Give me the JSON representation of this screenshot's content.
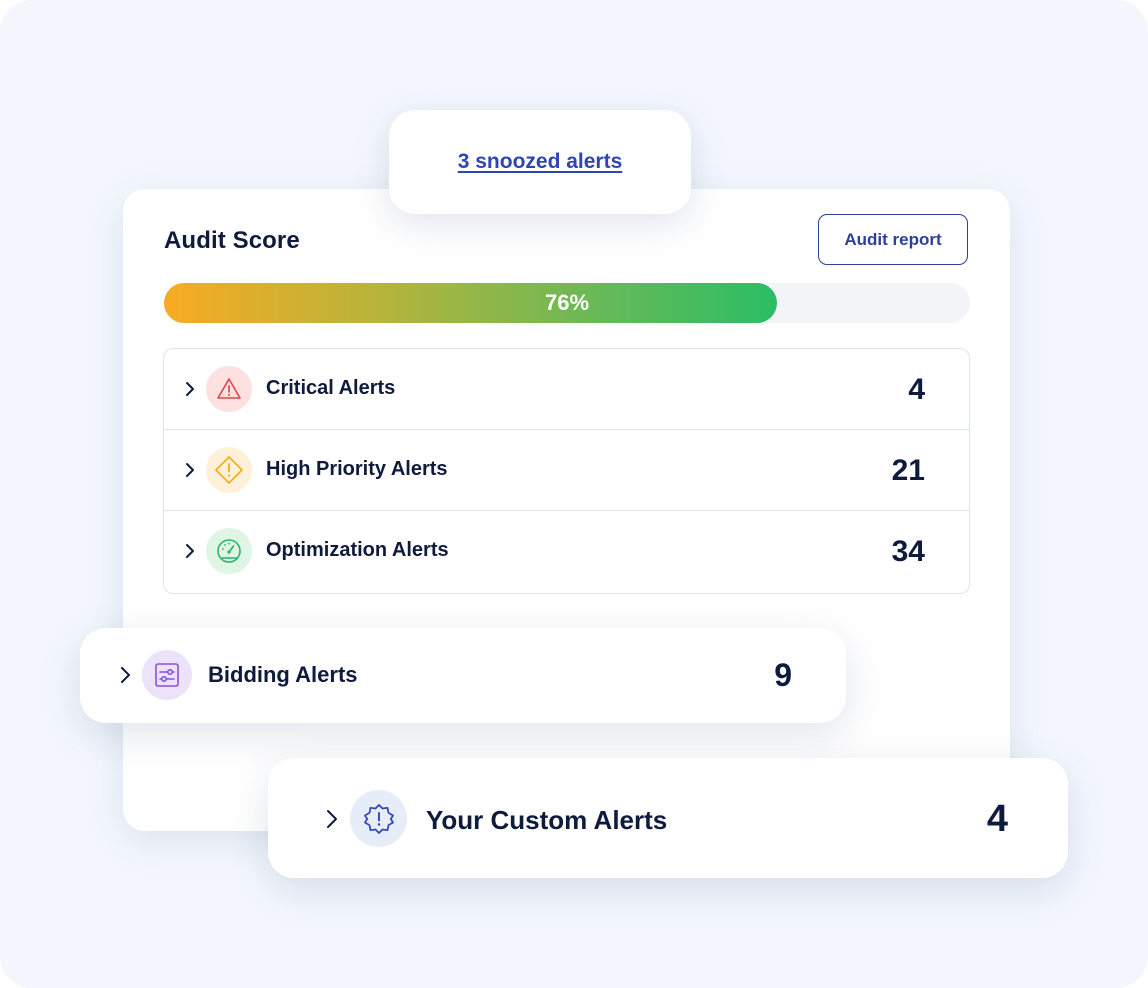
{
  "snoozed": {
    "link_text": "3 snoozed alerts"
  },
  "audit": {
    "title": "Audit Score",
    "report_button": "Audit report",
    "score_percent": 76,
    "score_label": "76%",
    "gradient_colors": [
      "#f8ab22",
      "#2bbd65"
    ]
  },
  "alerts": [
    {
      "label": "Critical Alerts",
      "count": "4",
      "icon": "warning-triangle-icon",
      "icon_bg": "#fde1e1",
      "icon_color": "#e0454d"
    },
    {
      "label": "High Priority Alerts",
      "count": "21",
      "icon": "warning-diamond-icon",
      "icon_bg": "#fff1d9",
      "icon_color": "#f2ae1c"
    },
    {
      "label": "Optimization Alerts",
      "count": "34",
      "icon": "gauge-icon",
      "icon_bg": "#dff5e6",
      "icon_color": "#2bb563"
    }
  ],
  "bidding": {
    "label": "Bidding Alerts",
    "count": "9",
    "icon": "sliders-icon",
    "icon_bg": "#ece3fb",
    "icon_color": "#8a4fe0"
  },
  "custom": {
    "label": "Your Custom Alerts",
    "count": "4",
    "icon": "badge-alert-icon",
    "icon_bg": "#e7ecf9",
    "icon_color": "#2f45b4"
  },
  "colors": {
    "text": "#0f1b3d",
    "link": "#2f45b4",
    "background": "#f3f7fd"
  }
}
